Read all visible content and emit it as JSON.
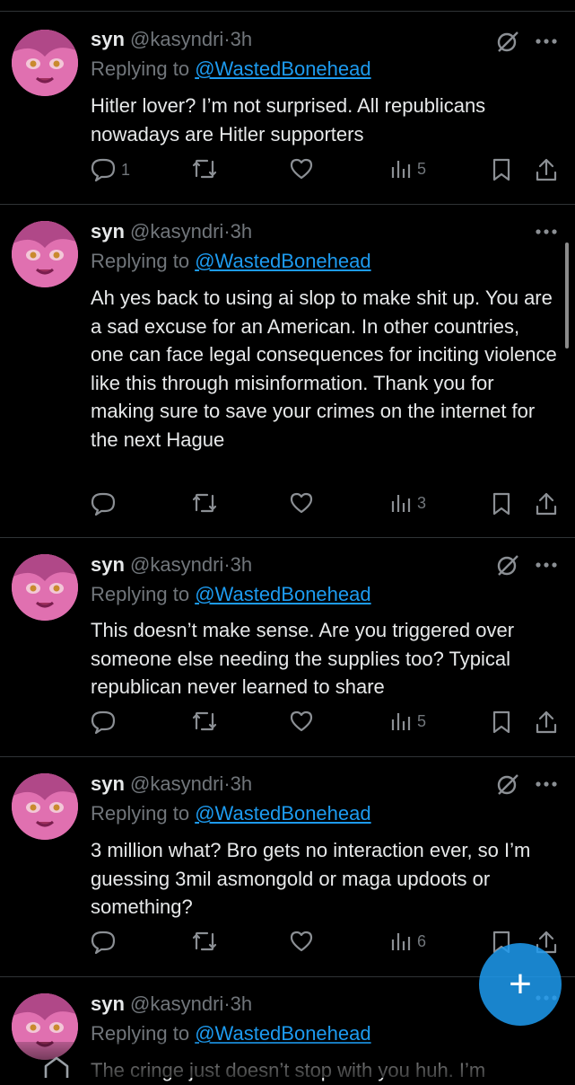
{
  "tweets": [
    {
      "name": "syn",
      "handle": "@kasyndri",
      "dot": "·",
      "time": "3h",
      "reply_prefix": "Replying to ",
      "reply_to": "@WastedBonehead",
      "text": "Hitler lover? I’m not surprised. All republicans nowadays are Hitler supporters",
      "replies": "1",
      "views": "5",
      "has_grok_icon": true
    },
    {
      "name": "syn",
      "handle": "@kasyndri",
      "dot": "·",
      "time": "3h",
      "reply_prefix": "Replying to ",
      "reply_to": "@WastedBonehead",
      "text": "Ah yes back to using ai slop to make shit up. You are a sad excuse for an American. In other countries, one can face legal consequences for inciting violence like this through misinformation. Thank you for making sure to save your crimes on the internet for the next Hague",
      "replies": "",
      "views": "3",
      "has_grok_icon": false
    },
    {
      "name": "syn",
      "handle": "@kasyndri",
      "dot": "·",
      "time": "3h",
      "reply_prefix": "Replying to ",
      "reply_to": "@WastedBonehead",
      "text": "This doesn’t make sense. Are you triggered over someone else needing the supplies too? Typical republican never learned to share",
      "replies": "",
      "views": "5",
      "has_grok_icon": true
    },
    {
      "name": "syn",
      "handle": "@kasyndri",
      "dot": "·",
      "time": "3h",
      "reply_prefix": "Replying to ",
      "reply_to": "@WastedBonehead",
      "text": "3 million what? Bro gets no interaction ever, so I’m guessing 3mil asmongold or maga updoots or something?",
      "replies": "",
      "views": "6",
      "has_grok_icon": true
    },
    {
      "name": "syn",
      "handle": "@kasyndri",
      "dot": "·",
      "time": "3h",
      "reply_prefix": "Replying to ",
      "reply_to": "@WastedBonehead",
      "text": "The cringe just doesn’t stop with you huh. I’m",
      "replies": "",
      "views": "",
      "has_grok_icon": true
    }
  ],
  "fab": {
    "label": "+"
  },
  "icons": {
    "reply": "reply-icon",
    "retweet": "retweet-icon",
    "like": "like-icon",
    "views": "views-icon",
    "bookmark": "bookmark-icon",
    "share": "share-icon",
    "grok": "grok-icon",
    "more": "more-icon",
    "home": "home-icon"
  },
  "colors": {
    "background": "#000000",
    "text": "#e7e9ea",
    "muted": "#71767b",
    "link": "#1d9bf0",
    "avatar": "#d65ea0"
  }
}
